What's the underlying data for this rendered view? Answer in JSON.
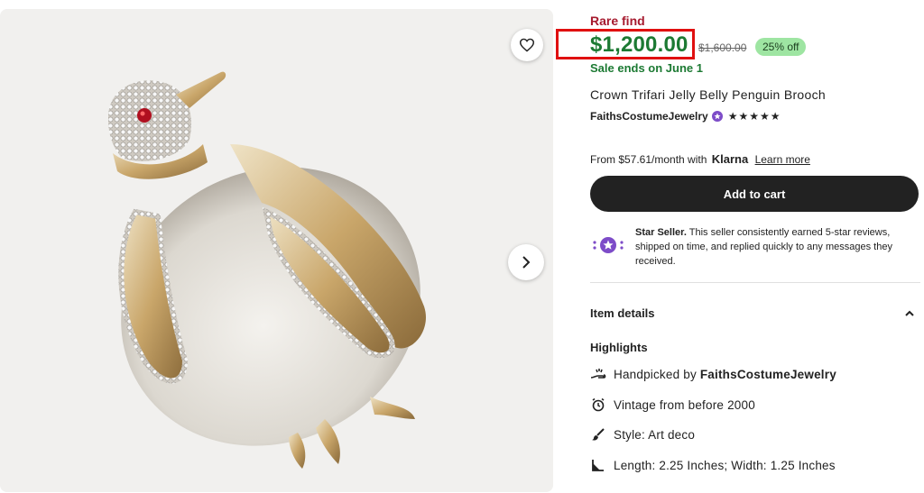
{
  "product_image": {
    "alt": "Crown Trifari Jelly Belly Penguin Brooch photo"
  },
  "buttons": {
    "favorite_icon": "heart-icon",
    "next_icon": "chevron-right-icon"
  },
  "price_block": {
    "rare_label": "Rare find",
    "price": "$1,200.00",
    "original_price": "$1,600.00",
    "discount": "25% off",
    "sale_ends": "Sale ends on June 1",
    "highlight_color": "#e01010",
    "price_color": "#1c7a33"
  },
  "title": "Crown Trifari Jelly Belly Penguin Brooch",
  "shop": {
    "name": "FaithsCostumeJewelry",
    "rating_stars": "★★★★★",
    "rating_value": 5
  },
  "klarna": {
    "prefix": "From $57.61/month with",
    "brand": "Klarna",
    "link": "Learn more"
  },
  "cart_button": "Add to cart",
  "star_seller": {
    "title": "Star Seller.",
    "text": "This seller consistently earned 5-star reviews, shipped on time, and replied quickly to any messages they received."
  },
  "item_details": {
    "header": "Item details",
    "highlights_title": "Highlights",
    "highlights": [
      {
        "icon": "hand-icon",
        "prefix": "Handpicked by ",
        "bold": "FaithsCostumeJewelry"
      },
      {
        "icon": "alarm-clock-icon",
        "text": "Vintage from before 2000"
      },
      {
        "icon": "brush-icon",
        "text": "Style: Art deco"
      },
      {
        "icon": "ruler-icon",
        "text": "Length: 2.25 Inches; Width: 1.25 Inches"
      }
    ]
  }
}
